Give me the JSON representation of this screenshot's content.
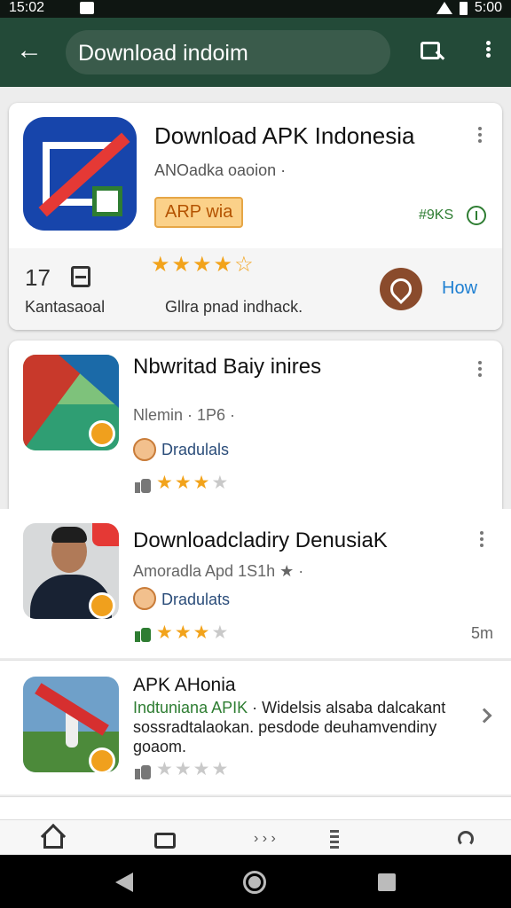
{
  "status_bar": {
    "time": "15:02",
    "clock_right": "5:00"
  },
  "search": {
    "query": "Download indoim"
  },
  "featured": {
    "title": "Download APK Indonesia",
    "subtitle": "ANOadka oaoion ·",
    "tag": "ARP wia",
    "price": "#9KS",
    "count": "17",
    "count_label": "Kantasaoal",
    "rating_text": "Gllra pnad indhack.",
    "action_label": "How"
  },
  "results": [
    {
      "title": "Nbwritad Baiy inires",
      "subtitle": "Nlemin · 1P6 ·",
      "developer": "Dradulals",
      "stars_filled": 3,
      "stars_total": 4
    },
    {
      "title": "Downloadcladiry DenusiaK",
      "subtitle": "Amoradla Apd 1S1h ★ ·",
      "developer": "Dradulats",
      "stars_filled": 3,
      "stars_total": 4,
      "size": "5m"
    },
    {
      "title": "APK AHonia",
      "developer": "Indtuniana APIK",
      "description": "· Widelsis alsaba dalcakant sossradtalaokan. pesdode deuhamvendiny goaom.",
      "stars_filled": 0,
      "stars_total": 4
    }
  ],
  "colors": {
    "appbar": "#234a38",
    "accent_star": "#f2a31b",
    "green": "#2e7d32",
    "link_blue": "#1e7fd1"
  },
  "icons": {
    "back": "arrow-left",
    "image_search": "image-search",
    "menu": "more-vertical",
    "home": "home",
    "apps": "apps",
    "list": "list",
    "share": "share"
  }
}
